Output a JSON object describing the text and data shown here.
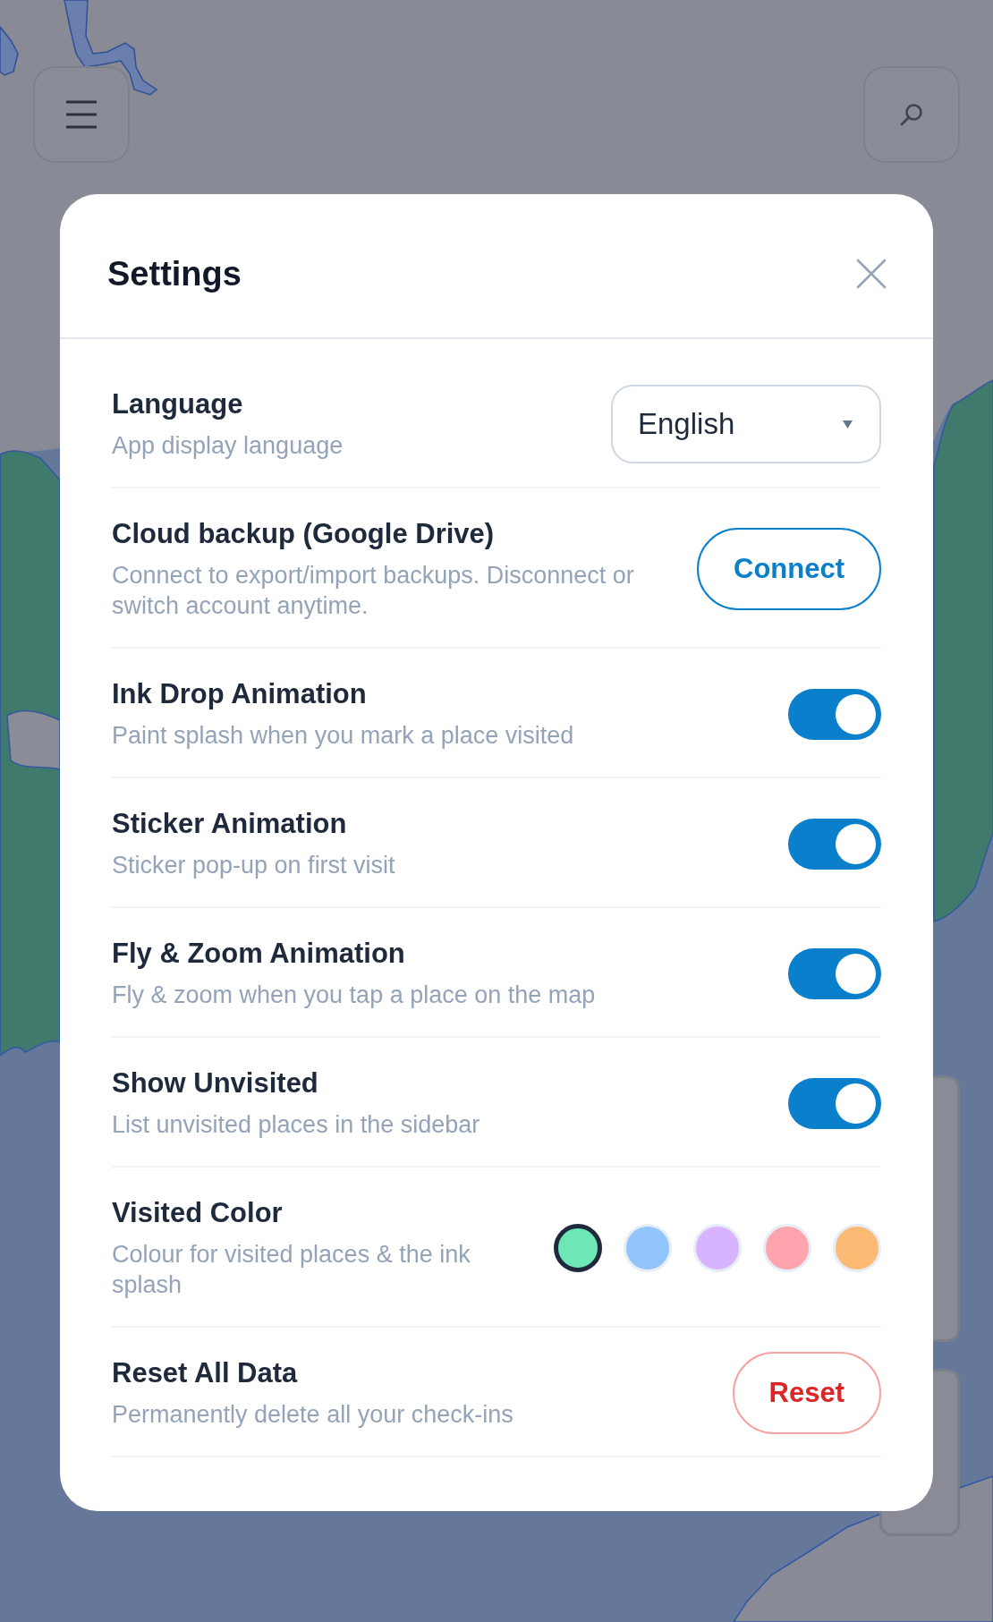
{
  "dialog": {
    "title": "Settings",
    "rows": [
      {
        "kind": "select",
        "title": "Language",
        "description": "App display language",
        "value": "English"
      },
      {
        "kind": "button",
        "title": "Cloud backup (Google Drive)",
        "description": "Connect to export/import backups. Disconnect or switch account anytime.",
        "button": {
          "label": "Connect",
          "kind": "primary"
        }
      },
      {
        "kind": "toggle",
        "title": "Ink Drop Animation",
        "description": "Paint splash when you mark a place visited",
        "on": true
      },
      {
        "kind": "toggle",
        "title": "Sticker Animation",
        "description": "Sticker pop-up on first visit",
        "on": true
      },
      {
        "kind": "toggle",
        "title": "Fly & Zoom Animation",
        "description": "Fly & zoom when you tap a place on the map",
        "on": true
      },
      {
        "kind": "toggle",
        "title": "Show Unvisited",
        "description": "List unvisited places in the sidebar",
        "on": true
      },
      {
        "kind": "colors",
        "title": "Visited Color",
        "description": "Colour for visited places & the ink splash",
        "swatches": [
          {
            "color": "#6ee7b7",
            "selected": true
          },
          {
            "color": "#93c5fd",
            "selected": false
          },
          {
            "color": "#d8b4fe",
            "selected": false
          },
          {
            "color": "#fda4af",
            "selected": false
          },
          {
            "color": "#fdba74",
            "selected": false
          }
        ]
      },
      {
        "kind": "button",
        "title": "Reset All Data",
        "description": "Permanently delete all your check-ins",
        "button": {
          "label": "Reset",
          "kind": "danger"
        }
      }
    ]
  }
}
